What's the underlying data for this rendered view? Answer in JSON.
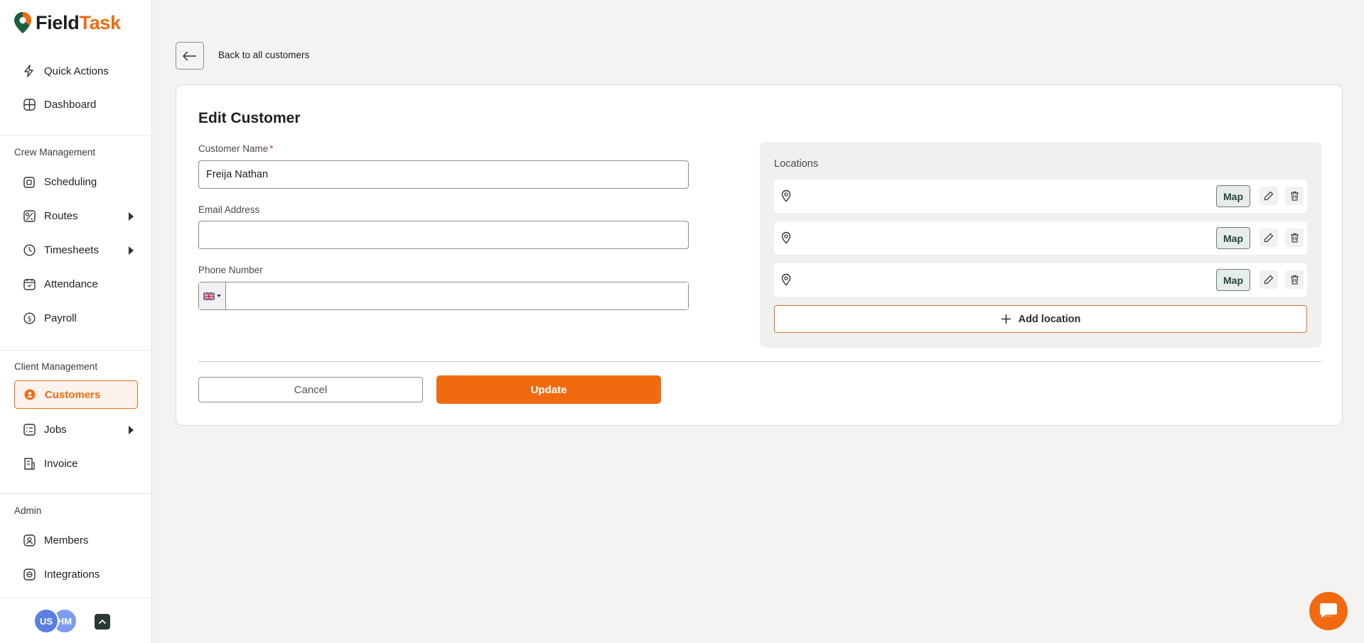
{
  "brand": {
    "name_part1": "Field",
    "name_part2": "Task",
    "accent": "#f26a10",
    "primary_text": "#1f1f1f"
  },
  "sidebar": {
    "top_items": [
      {
        "label": "Quick Actions",
        "icon": "bolt-icon"
      },
      {
        "label": "Dashboard",
        "icon": "dashboard-icon"
      }
    ],
    "sections": [
      {
        "title": "Crew Management",
        "items": [
          {
            "label": "Scheduling",
            "icon": "calendar-icon",
            "expandable": false
          },
          {
            "label": "Routes",
            "icon": "route-icon",
            "expandable": true
          },
          {
            "label": "Timesheets",
            "icon": "clock-icon",
            "expandable": true
          },
          {
            "label": "Attendance",
            "icon": "attendance-icon",
            "expandable": false
          },
          {
            "label": "Payroll",
            "icon": "dollar-icon",
            "expandable": false
          }
        ]
      },
      {
        "title": "Client Management",
        "items": [
          {
            "label": "Customers",
            "icon": "customer-icon",
            "active": true
          },
          {
            "label": "Jobs",
            "icon": "checklist-icon",
            "expandable": true
          },
          {
            "label": "Invoice",
            "icon": "invoice-icon",
            "expandable": false
          }
        ]
      },
      {
        "title": "Admin",
        "items": [
          {
            "label": "Members",
            "icon": "member-icon"
          },
          {
            "label": "Integrations",
            "icon": "integrations-icon"
          }
        ]
      }
    ],
    "avatars": [
      "US",
      "HM"
    ]
  },
  "main": {
    "back_label": "Back to all customers",
    "title": "Edit Customer",
    "fields": {
      "customer_name_label": "Customer Name",
      "customer_name_required": "*",
      "customer_name_value": "Freija Nathan",
      "email_label": "Email Address",
      "email_value": "",
      "phone_label": "Phone Number",
      "phone_value": "",
      "phone_country": "GB"
    },
    "locations": {
      "title": "Locations",
      "rows": [
        {
          "address": "",
          "map_label": "Map"
        },
        {
          "address": "",
          "map_label": "Map"
        },
        {
          "address": "",
          "map_label": "Map"
        }
      ],
      "add_label": "Add location"
    },
    "cancel_label": "Cancel",
    "update_label": "Update"
  }
}
